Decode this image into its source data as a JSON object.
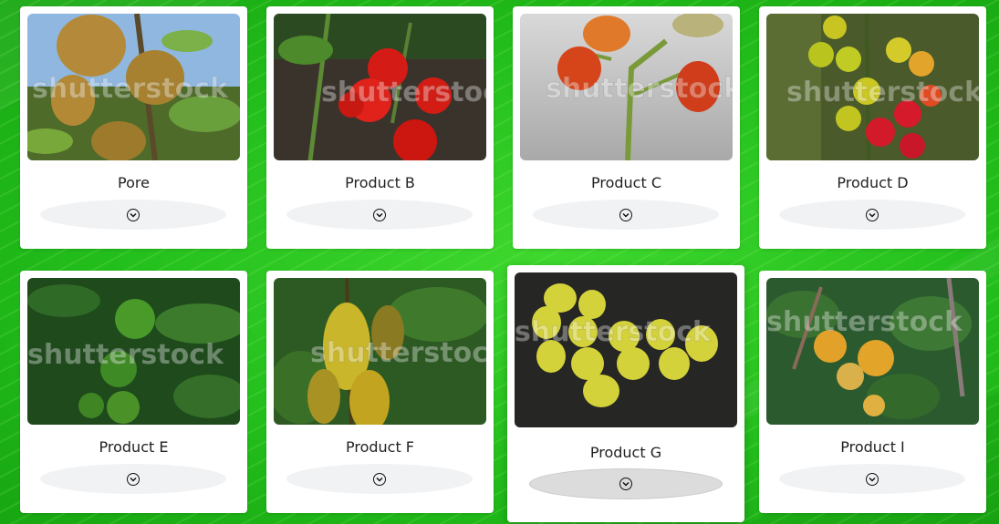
{
  "products": [
    {
      "name": "Pore",
      "image": "pear-tree-photo",
      "watermark": "shutterstock"
    },
    {
      "name": "Product B",
      "image": "tomatoes-photo",
      "watermark": "shutterstock"
    },
    {
      "name": "Product C",
      "image": "tomato-plant-photo",
      "watermark": "shutterstock"
    },
    {
      "name": "Product D",
      "image": "yellow-red-berries-photo",
      "watermark": "shutterstock"
    },
    {
      "name": "Product E",
      "image": "limes-photo",
      "watermark": "shutterstock"
    },
    {
      "name": "Product F",
      "image": "starfruit-photo",
      "watermark": "shutterstock"
    },
    {
      "name": "Product G",
      "image": "gooseberries-photo",
      "watermark": "shutterstock"
    },
    {
      "name": "Product I",
      "image": "yellow-fruits-photo",
      "watermark": "shutterstock"
    }
  ],
  "expand_icon": "chevron-down-icon",
  "colors": {
    "background": "#27c21f",
    "card": "#ffffff",
    "expand_button": "#f1f2f4",
    "expand_button_active": "#dcdcdc"
  }
}
